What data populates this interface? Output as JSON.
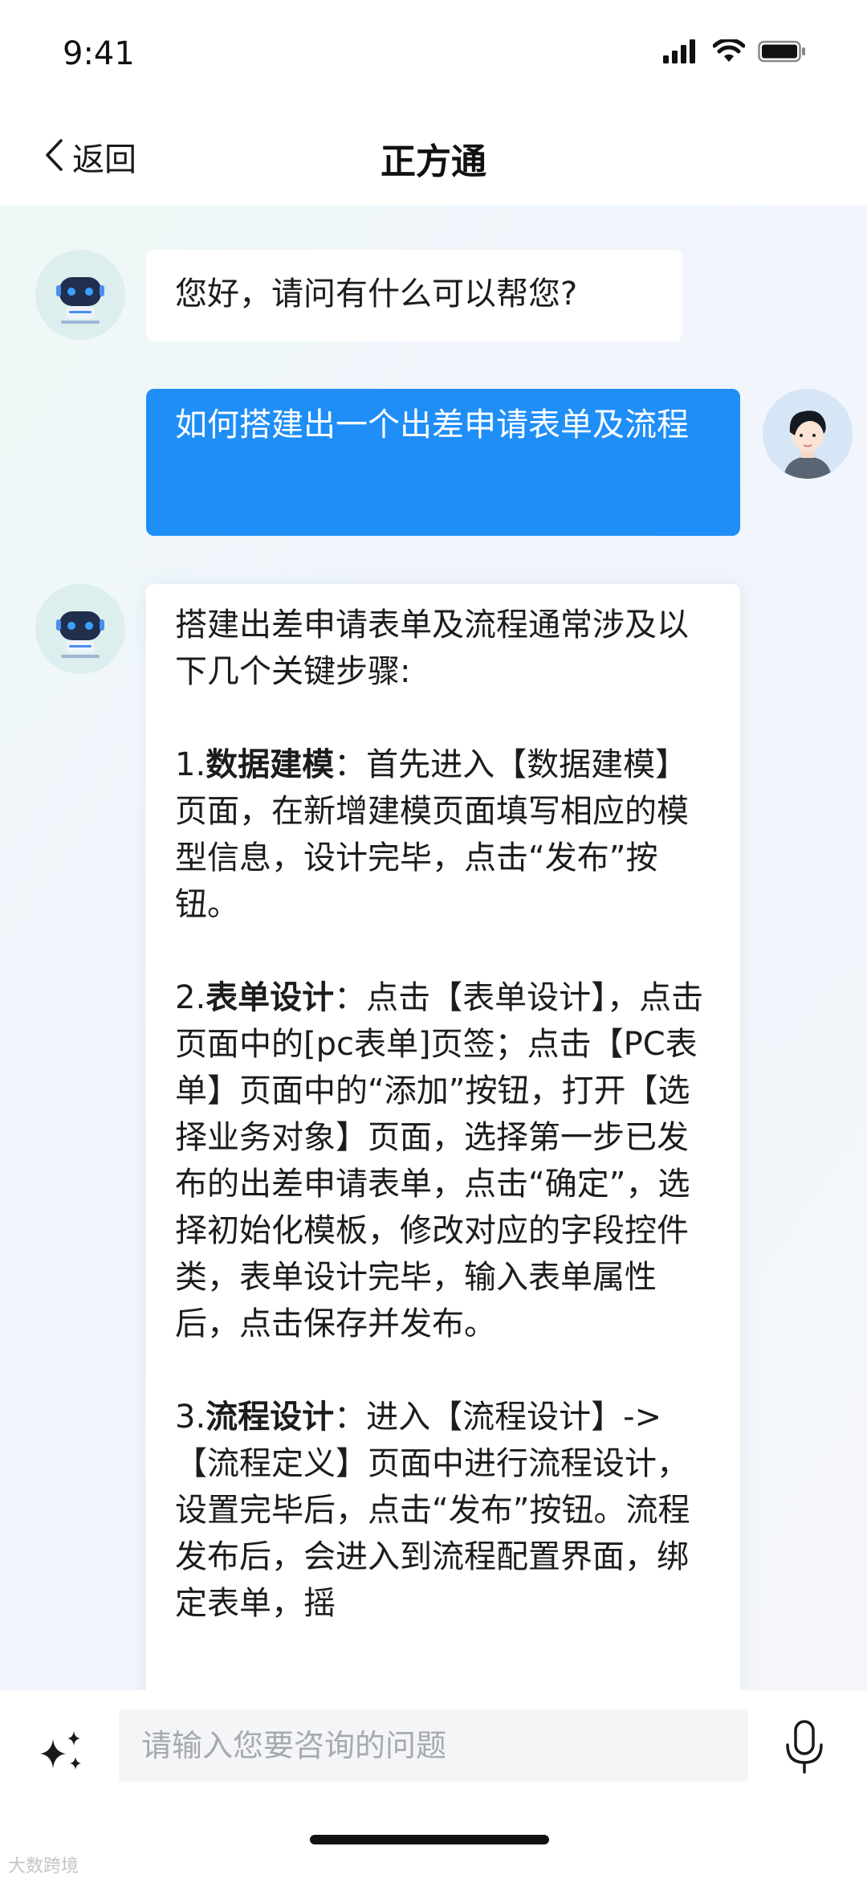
{
  "status_bar": {
    "time": "9:41",
    "icons": [
      "signal-icon",
      "wifi-icon",
      "battery-icon"
    ]
  },
  "nav": {
    "back_label": "返回",
    "title": "正方通"
  },
  "messages": {
    "greeting": "您好，请问有什么可以帮您?",
    "user_question": "如何搭建出一个出差申请表单及流程",
    "answer_intro": "搭建出差申请表单及流程通常涉及以下几个关键步骤:",
    "steps": [
      {
        "num": "1.",
        "title": "数据建模",
        "body": "：首先进入【数据建模】页面，在新增建模页面填写相应的模型信息，设计完毕，点击“发布”按钮。"
      },
      {
        "num": "2.",
        "title": "表单设计",
        "body": "：点击【表单设计】，点击页面中的[pc表单]页签；点击【PC表单】页面中的“添加”按钮，打开【选择业务对象】页面，选择第一步已发布的出差申请表单，点击“确定”，选择初始化模板，修改对应的字段控件类，表单设计完毕，输入表单属性后，点击保存并发布。"
      },
      {
        "num": "3.",
        "title": "流程设计",
        "body": "：进入【流程设计】->【流程定义】页面中进行流程设计，设置完毕后，点击“发布”按钮。流程发布后，会进入到流程配置界面，绑定表单，摇"
      }
    ]
  },
  "input": {
    "placeholder": "请输入您要咨询的问题"
  },
  "watermark": "大数跨境",
  "colors": {
    "accent": "#1f8ef7",
    "bot_bubble": "#ffffff",
    "chat_bg": "#f2f5fb"
  }
}
